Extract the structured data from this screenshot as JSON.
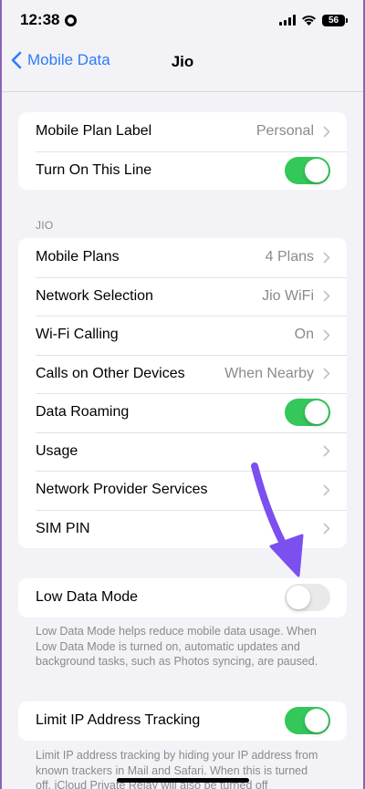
{
  "status_bar": {
    "time": "12:38",
    "battery": "56"
  },
  "nav": {
    "back_label": "Mobile Data",
    "title": "Jio"
  },
  "group1": {
    "rows": [
      {
        "label": "Mobile Plan Label",
        "value": "Personal"
      },
      {
        "label": "Turn On This Line",
        "toggle": true
      }
    ]
  },
  "section_header": "JIO",
  "group2": {
    "rows": [
      {
        "label": "Mobile Plans",
        "value": "4 Plans"
      },
      {
        "label": "Network Selection",
        "value": "Jio WiFi"
      },
      {
        "label": "Wi-Fi Calling",
        "value": "On"
      },
      {
        "label": "Calls on Other Devices",
        "value": "When Nearby"
      },
      {
        "label": "Data Roaming",
        "toggle": true
      },
      {
        "label": "Usage",
        "value": ""
      },
      {
        "label": "Network Provider Services",
        "value": ""
      },
      {
        "label": "SIM PIN",
        "value": ""
      }
    ]
  },
  "low_data": {
    "label": "Low Data Mode",
    "toggle": false,
    "footer": "Low Data Mode helps reduce mobile data usage. When Low Data Mode is turned on, automatic updates and background tasks, such as Photos syncing, are paused."
  },
  "limit_ip": {
    "label": "Limit IP Address Tracking",
    "toggle": true,
    "footer": "Limit IP address tracking by hiding your IP address from known trackers in Mail and Safari. When this is turned off, iCloud Private Relay will also be turned off"
  },
  "colors": {
    "accent": "#2d7cf6",
    "toggle_on": "#34c759",
    "arrow": "#7b4ff0"
  }
}
